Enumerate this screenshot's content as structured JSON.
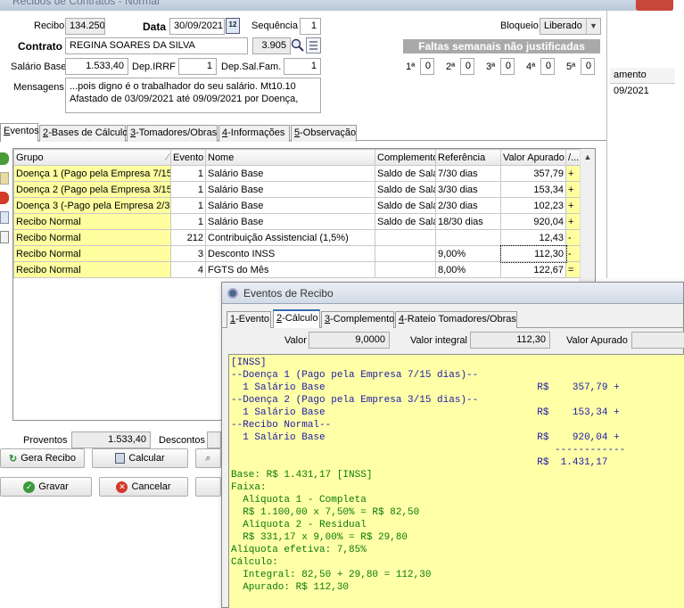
{
  "window": {
    "title": "Recibos de Contratos - Normal"
  },
  "header": {
    "recibo_label": "Recibo",
    "recibo_value": "134.250",
    "data_label": "Data",
    "data_value": "30/09/2021",
    "sequencia_label": "Sequência",
    "sequencia_value": "1",
    "bloqueio_label": "Bloqueio",
    "bloqueio_value": "Liberado",
    "contrato_label": "Contrato",
    "contrato_value": "REGINA SOARES DA SILVA",
    "contrato_code": "3.905",
    "salario_label": "Salário Base",
    "salario_value": "1.533,40",
    "dep_irrf_label": "Dep.IRRF",
    "dep_irrf_value": "1",
    "dep_sal_label": "Dep.Sal.Fam.",
    "dep_sal_value": "1",
    "mensagens_label": "Mensagens",
    "mensagens_line1": "...pois digno é o trabalhador do seu salário. Mt10.10",
    "mensagens_line2": "Afastado de 03/09/2021 até 09/09/2021 por Doença,"
  },
  "faltas": {
    "title": "Faltas semanais não justificadas",
    "weeks": [
      {
        "label": "1ª",
        "value": "0"
      },
      {
        "label": "2ª",
        "value": "0"
      },
      {
        "label": "3ª",
        "value": "0"
      },
      {
        "label": "4ª",
        "value": "0"
      },
      {
        "label": "5ª",
        "value": "0"
      }
    ]
  },
  "bg_list": {
    "header": "amento",
    "value": "09/2021"
  },
  "tabs": [
    {
      "key": "E",
      "rest": "ventos"
    },
    {
      "key": "2",
      "rest": "-Bases de Cálculo"
    },
    {
      "key": "3",
      "rest": "-Tomadores/Obras"
    },
    {
      "key": "4",
      "rest": "-Informações"
    },
    {
      "key": "5",
      "rest": "-Observação"
    }
  ],
  "grid": {
    "columns": [
      "Grupo",
      "Evento",
      "Nome",
      "Complemento",
      "Referência",
      "Valor Apurado",
      "/..."
    ],
    "rows": [
      {
        "grupo": "Doença 1 (Pago pela Empresa 7/15 d",
        "evento": "1",
        "nome": "Salário Base",
        "complemento": "Saldo de Salá",
        "referencia": "7/30 dias",
        "valor": "357,79",
        "sinal": "+"
      },
      {
        "grupo": "Doença 2 (Pago pela Empresa 3/15 d",
        "evento": "1",
        "nome": "Salário Base",
        "complemento": "Saldo de Salá",
        "referencia": "3/30 dias",
        "valor": "153,34",
        "sinal": "+"
      },
      {
        "grupo": "Doença 3 (-Pago pela Empresa 2/3 d",
        "evento": "1",
        "nome": "Salário Base",
        "complemento": "Saldo de Salá",
        "referencia": "2/30 dias",
        "valor": "102,23",
        "sinal": "+"
      },
      {
        "grupo": "Recibo Normal",
        "evento": "1",
        "nome": "Salário Base",
        "complemento": "Saldo de Salá",
        "referencia": "18/30 dias",
        "valor": "920,04",
        "sinal": "+"
      },
      {
        "grupo": "Recibo Normal",
        "evento": "212",
        "nome": "Contribuição Assistencial (1,5%)",
        "complemento": "",
        "referencia": "",
        "valor": "12,43",
        "sinal": "-"
      },
      {
        "grupo": "Recibo Normal",
        "evento": "3",
        "nome": "Desconto INSS",
        "complemento": "",
        "referencia": "9,00%",
        "valor": "112,30",
        "sinal": "-"
      },
      {
        "grupo": "Recibo Normal",
        "evento": "4",
        "nome": "FGTS do Mês",
        "complemento": "",
        "referencia": "8,00%",
        "valor": "122,67",
        "sinal": "="
      }
    ]
  },
  "footer": {
    "proventos_label": "Proventos",
    "proventos_value": "1.533,40",
    "descontos_label": "Descontos",
    "gera_recibo": "Gera Recibo",
    "calcular": "Calcular",
    "gravar": "Gravar",
    "cancelar": "Cancelar"
  },
  "dialog": {
    "title": "Eventos de Recibo",
    "tabs": [
      {
        "key": "1",
        "rest": "-Evento"
      },
      {
        "key": "2",
        "rest": "-Cálculo"
      },
      {
        "key": "3",
        "rest": "-Complemento"
      },
      {
        "key": "4",
        "rest": "-Rateio Tomadores/Obras"
      }
    ],
    "valor_label": "Valor",
    "valor_value": "9,0000",
    "valor_integral_label": "Valor integral",
    "valor_integral_value": "112,30",
    "valor_apurado_label": "Valor Apurado",
    "calc_lines": [
      "[INSS]",
      "--Doença 1 (Pago pela Empresa 7/15 dias)--",
      "  1 Salário Base                                    R$    357,79 +",
      "--Doença 2 (Pago pela Empresa 3/15 dias)--",
      "  1 Salário Base                                    R$    153,34 +",
      "--Recibo Normal--",
      "  1 Salário Base                                    R$    920,04 +",
      "                                                       ------------",
      "                                                    R$  1.431,17",
      "Base: R$ 1.431,17 [INSS]",
      "Faixa:",
      "  Alíquota 1 - Completa",
      "  R$ 1.100,00 x 7,50% = R$ 82,50",
      "  Alíquota 2 - Residual",
      "  R$ 331,17 x 9,00% = R$ 29,80",
      "Alíquota efetiva: 7,85%",
      "Cálculo:",
      "  Integral: 82,50 + 29,80 = 112,30",
      "  Apurado: R$ 112,30"
    ]
  }
}
